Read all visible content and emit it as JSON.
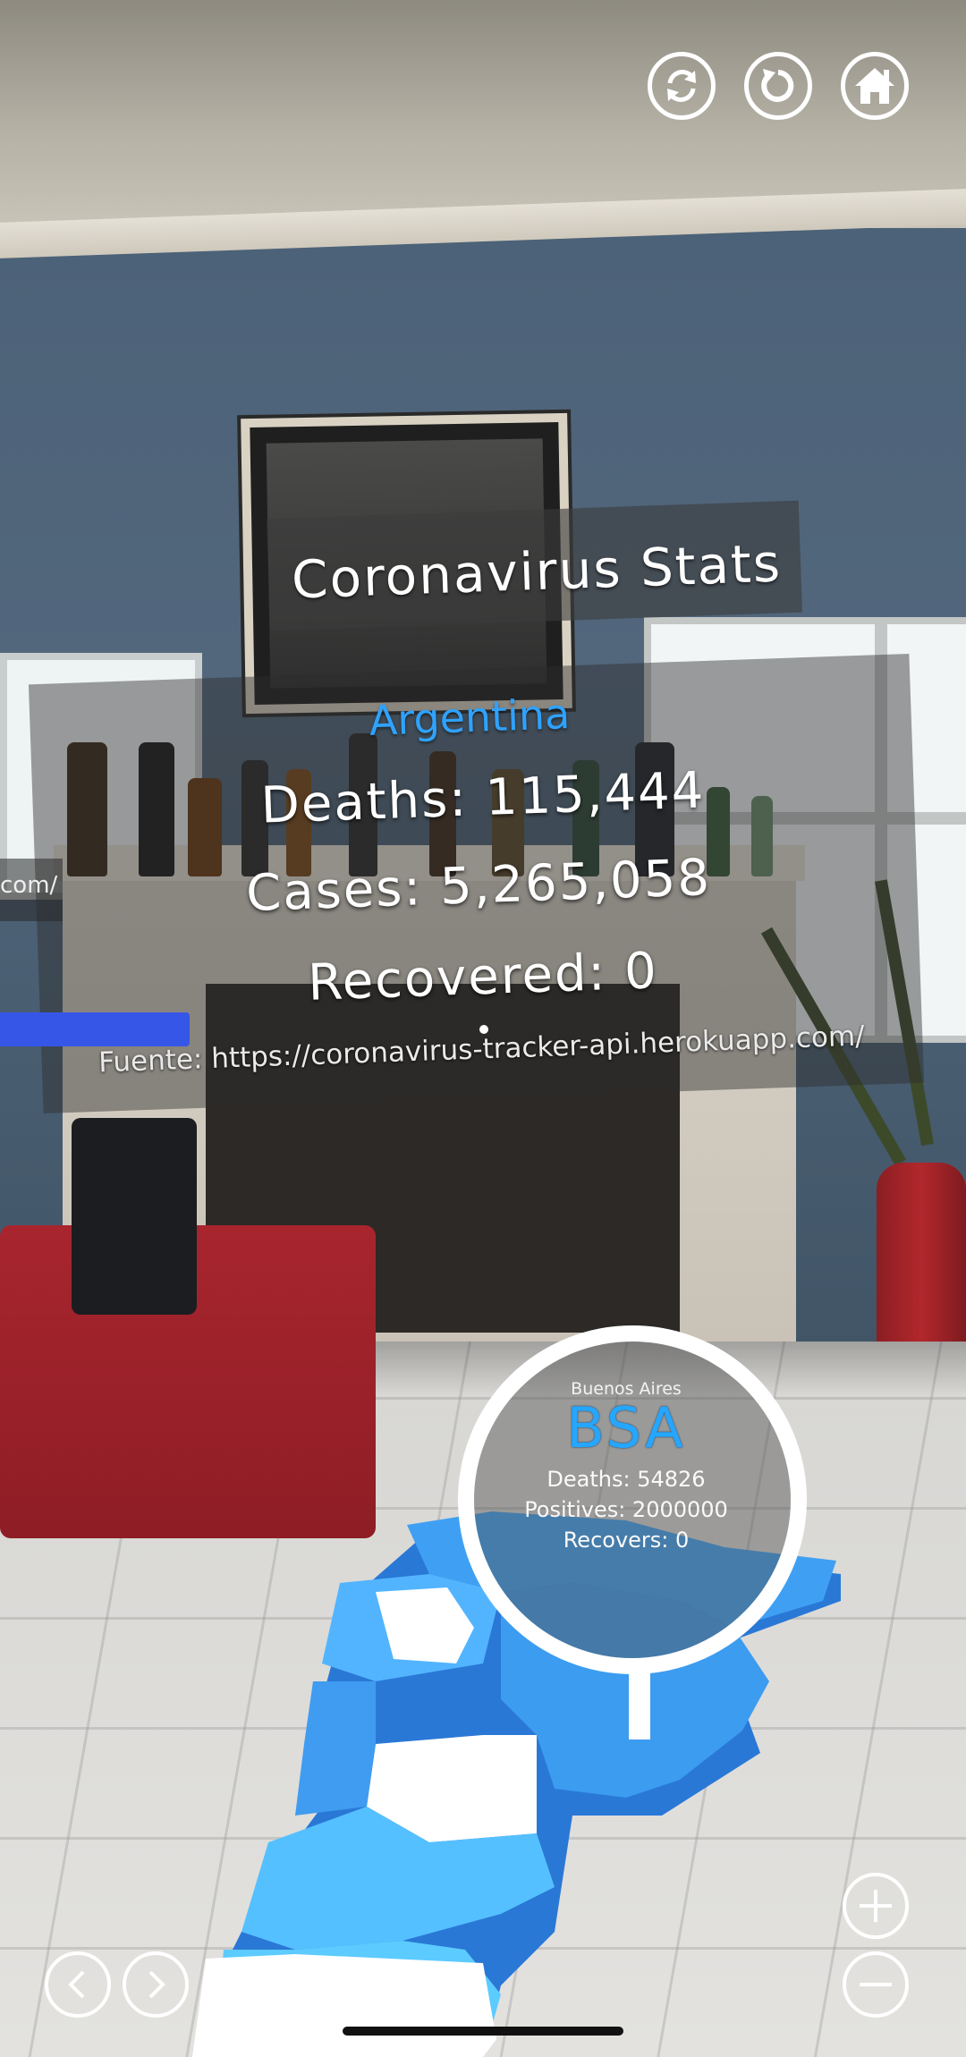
{
  "toolbar": {
    "sync_icon": "sync-icon",
    "reset_icon": "rotate-icon",
    "home_icon": "home-icon"
  },
  "stats": {
    "title": "Coronavirus Stats",
    "country": "Argentina",
    "deaths": "Deaths: 115,444",
    "cases": "Cases: 5,265,058",
    "recovered": "Recovered: 0",
    "source": "Fuente: https://coronavirus-tracker-api.herokuapp.com/",
    "country_color": "#2fa2ff"
  },
  "left_panel": {
    "fragment": "com/"
  },
  "province": {
    "name": "Buenos Aires",
    "code": "BSA",
    "deaths": "Deaths: 54826",
    "positives": "Positives: 2000000",
    "recovers": "Recovers: 0",
    "code_color": "#25a6ff"
  },
  "controls": {
    "prev_icon": "chevron-left-icon",
    "next_icon": "chevron-right-icon",
    "zoom_in_icon": "plus-icon",
    "zoom_out_icon": "minus-icon"
  }
}
